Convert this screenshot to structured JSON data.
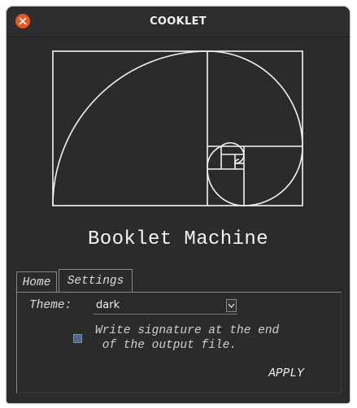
{
  "window": {
    "title": "COOKLET"
  },
  "app": {
    "title": "Booklet Machine",
    "logo_icon": "golden-spiral-logo"
  },
  "tabs": [
    {
      "label": "Home",
      "selected": false
    },
    {
      "label": "Settings",
      "selected": true
    }
  ],
  "settings": {
    "theme_label": "Theme:",
    "theme_value": "dark",
    "signature_line1": "Write signature at the end",
    "signature_line2": " of the output file.",
    "signature_checked": false,
    "apply_label": "APPLY"
  },
  "colors": {
    "window_bg": "#2b2b2b",
    "close_button": "#e95420",
    "checkbox": "#4b6a8e"
  }
}
